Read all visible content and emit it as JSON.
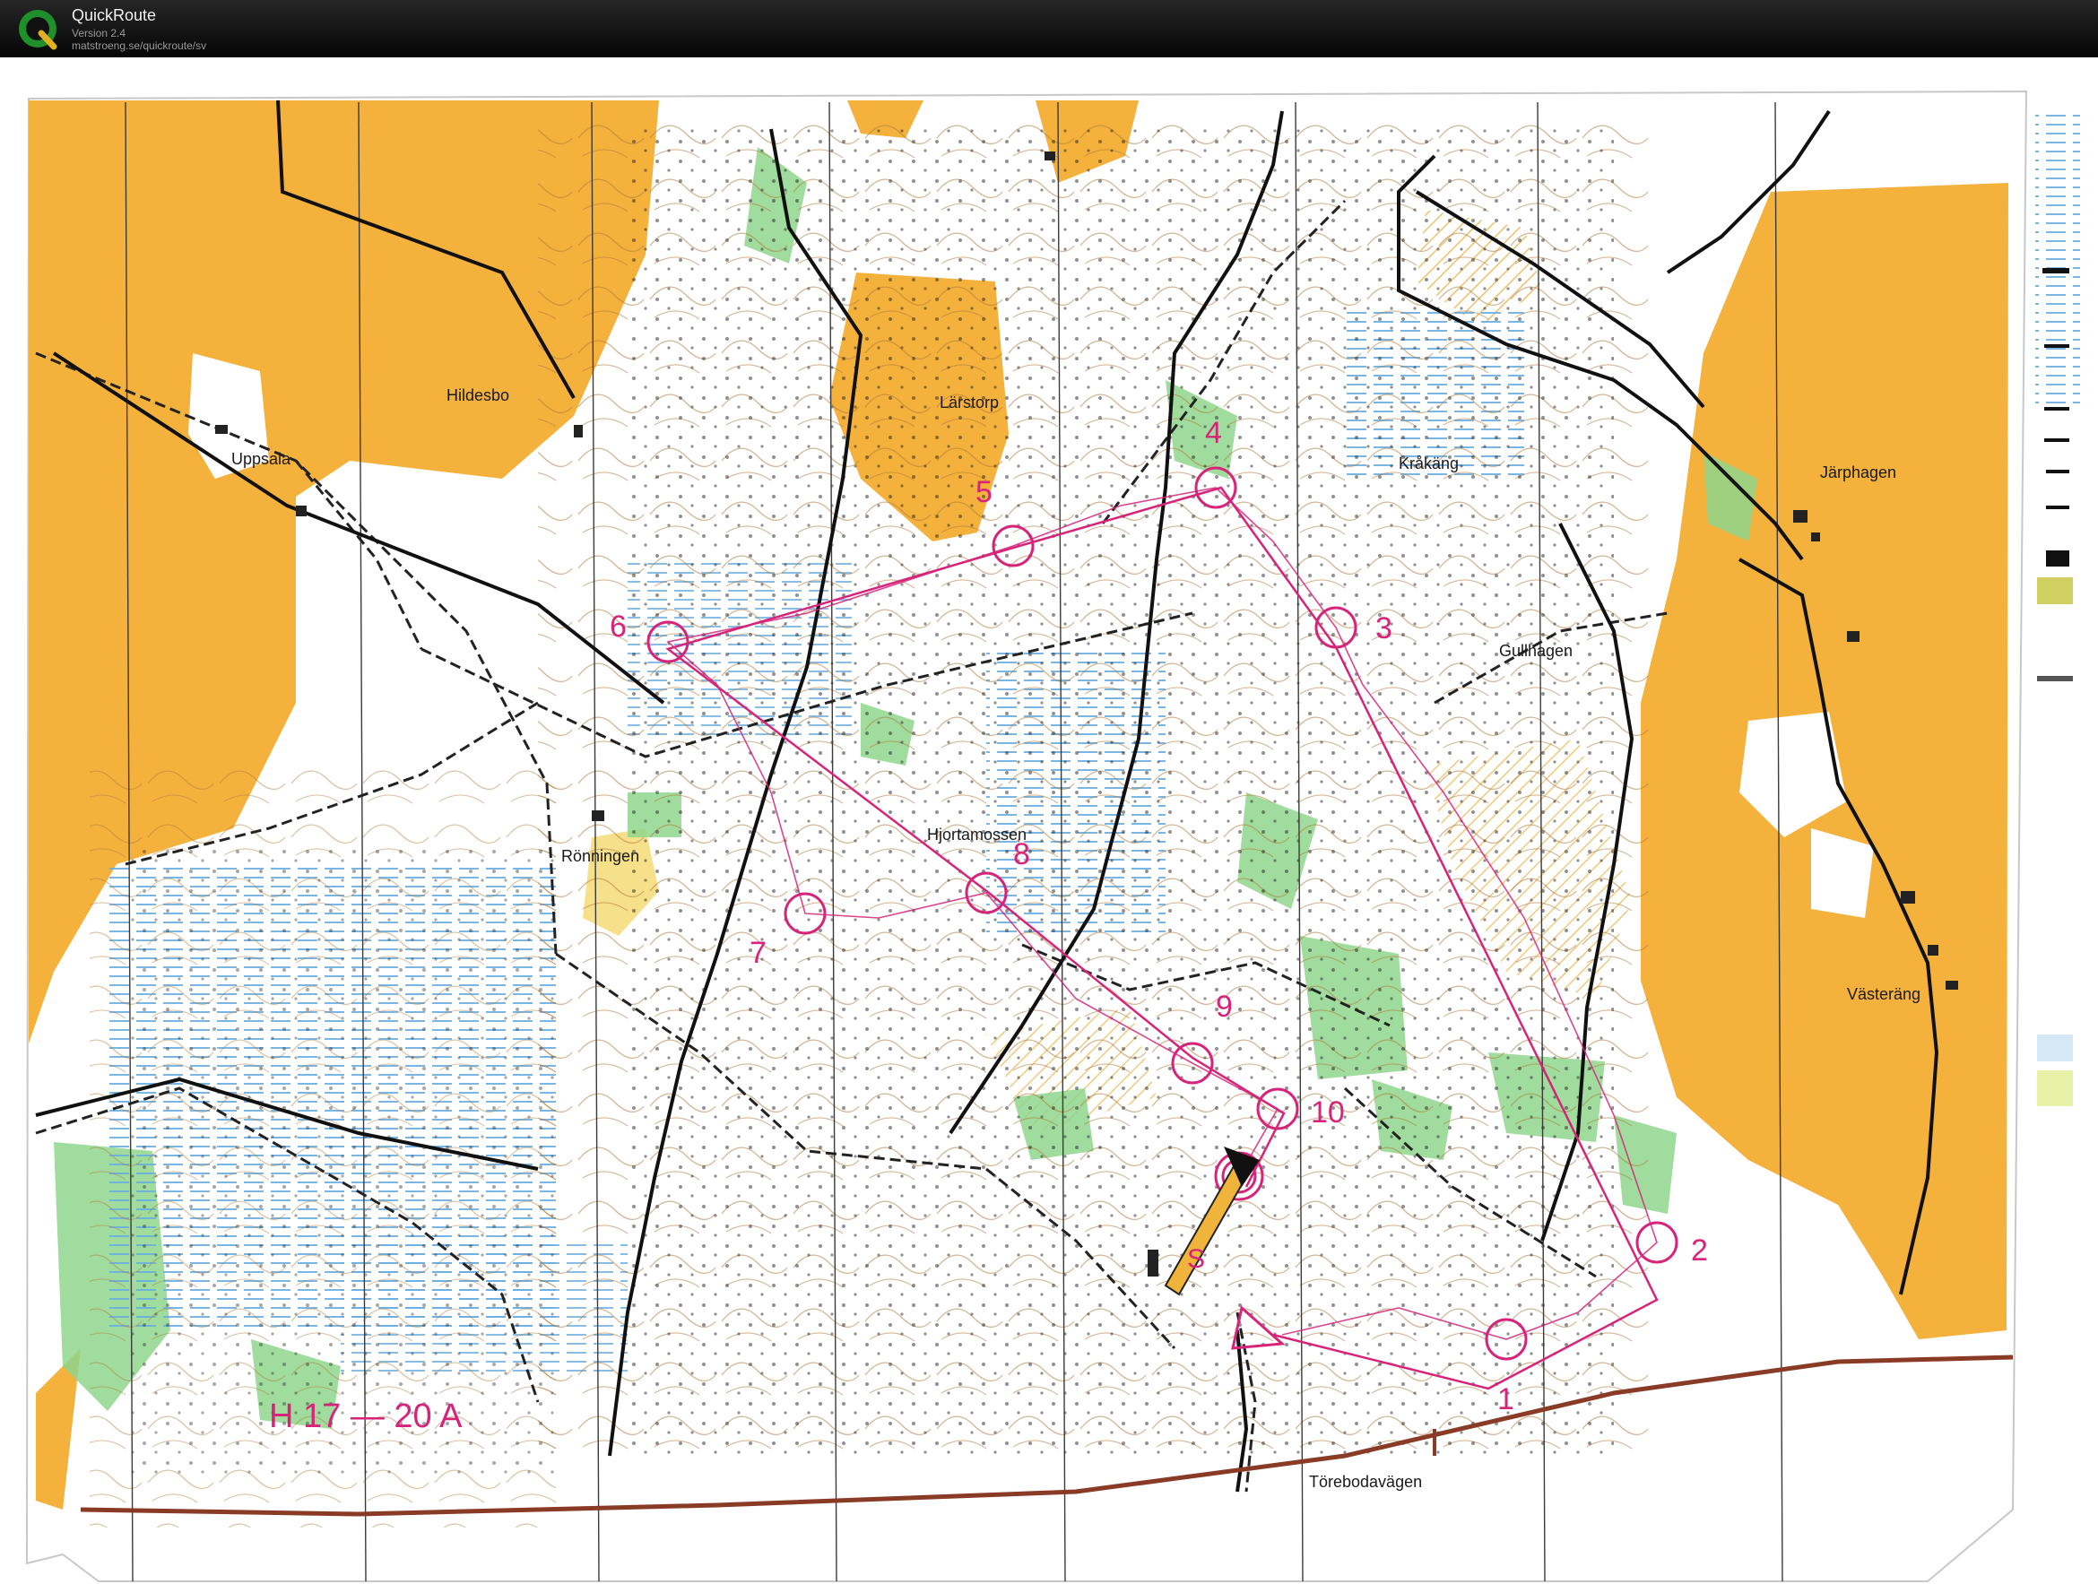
{
  "app": {
    "title": "QuickRoute",
    "version": "Version 2.4",
    "url": "matstroeng.se/quickroute/sv"
  },
  "colors": {
    "open_land": "#f4b13c",
    "forest": "#ffffff",
    "green": "#8fd68c",
    "marsh": "#8cc3e6",
    "course": "#d6247a",
    "road_main": "#8a3b26",
    "titlebar": "#111111"
  },
  "map": {
    "place_names": {
      "hildesbo": "Hildesbo",
      "uppsala": "Uppsala",
      "larstorp": "Lärstorp",
      "krakang": "Kråkäng",
      "jarphagen": "Järphagen",
      "gullhagen": "Gullhagen",
      "ronningen": "Rönningen",
      "hjortamossen": "Hjortamossen",
      "vasterang": "Västeräng",
      "torebodavagen": "Törebodavägen"
    },
    "course": {
      "name": "H 17 — 20 A",
      "start_label": "S",
      "controls": [
        "1",
        "2",
        "3",
        "4",
        "5",
        "6",
        "7",
        "8",
        "9",
        "10"
      ]
    }
  }
}
